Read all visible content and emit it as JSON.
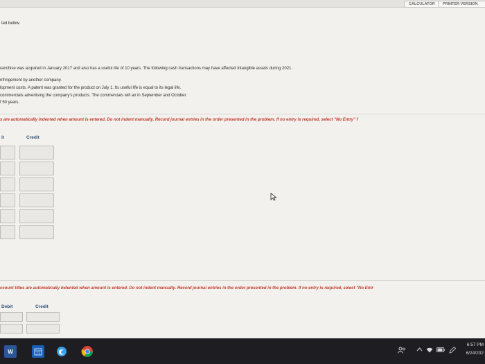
{
  "header": {
    "calculator_label": "CALCULATOR",
    "printer_label": "PRINTER VERSION"
  },
  "content": {
    "intro_fragment": "ted below.",
    "problem_line": "ranchise was acquired in January 2017 and also has a useful life of 10 years. The following cash transactions may have affected intangible assets during 2021.",
    "transactions": [
      "nfringement by another company.",
      "lopment costs. A patent was granted for the product on July 1. Its useful life is equal to its legal life.",
      " commercials advertising the company's products. The commercials will air in September and October.",
      "f 50 years."
    ]
  },
  "journal1": {
    "instruction": "s are automatically indented when amount is entered. Do not indent manually. Record journal entries in the order presented in the problem. If no entry is required, select \"No Entry\" f",
    "debit_header": "it",
    "credit_header": "Credit",
    "row_count": 6
  },
  "journal2": {
    "instruction": "ccount titles are automatically indented when amount is entered. Do not indent manually. Record journal entries in the order presented in the problem. If no entry is required, select \"No Entr",
    "debit_header": "Debit",
    "credit_header": "Credit",
    "row_count": 2
  },
  "taskbar": {
    "word_icon_letter": "W",
    "clock_time": "6:57 PM",
    "clock_date": "6/24/202",
    "accent_colors": {
      "word": "#2b579a",
      "calendar": "#1a5fb4",
      "edge": "#3aa0e6",
      "chrome_red": "#db4437",
      "chrome_yellow": "#f4b400",
      "chrome_green": "#0f9d58"
    }
  }
}
